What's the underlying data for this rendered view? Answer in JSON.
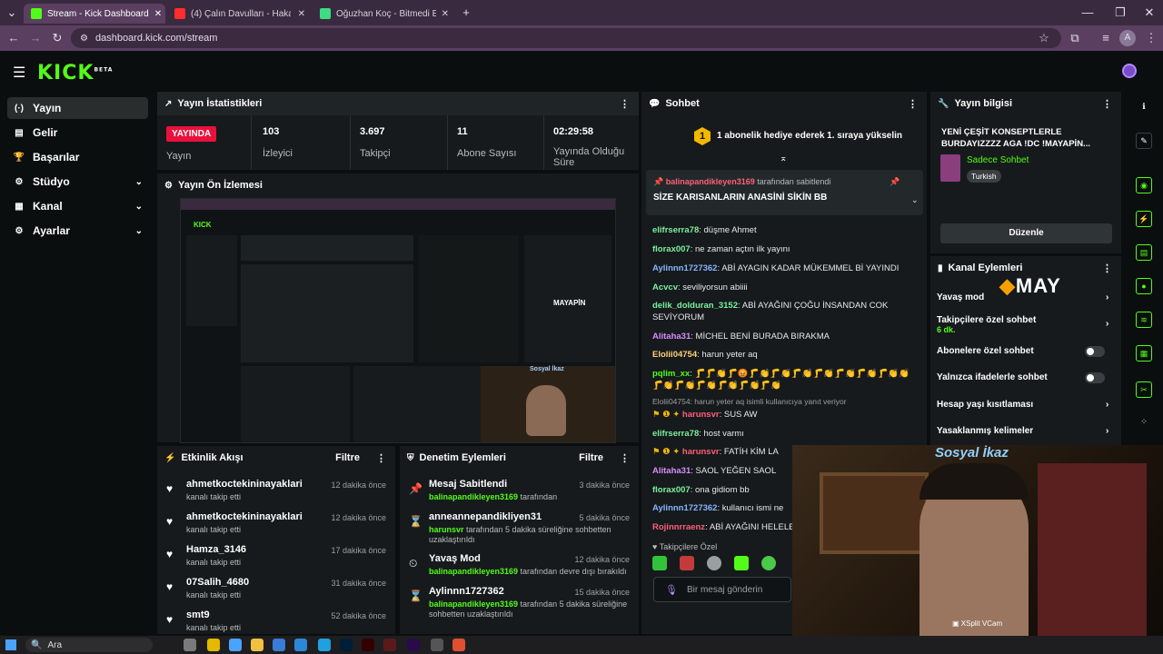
{
  "browser": {
    "tabs": [
      {
        "label": "Stream - Kick Dashboard",
        "active": true
      },
      {
        "label": "(4) Çalın Davulları - Hakan Yeşil..."
      },
      {
        "label": "Oğuzhan Koç - Bitmedi Elem - ..."
      }
    ],
    "new_tab": "+",
    "url": "dashboard.kick.com/stream",
    "profile_initial": "A"
  },
  "header": {
    "logo": "KICK",
    "logo_beta": "BETA"
  },
  "sidebar": {
    "items": [
      {
        "label": "Yayın",
        "icon": "(·)"
      },
      {
        "label": "Gelir",
        "icon": "▤"
      },
      {
        "label": "Başarılar",
        "icon": "🏆"
      },
      {
        "label": "Stüdyo",
        "icon": "⚙"
      },
      {
        "label": "Kanal",
        "icon": "▦"
      },
      {
        "label": "Ayarlar",
        "icon": "⚙"
      }
    ]
  },
  "stats": {
    "title": "Yayın İstatistikleri",
    "live_label": "YAYINDA",
    "status_label": "Yayın",
    "viewers": {
      "value": "103",
      "label": "İzleyici"
    },
    "followers": {
      "value": "3.697",
      "label": "Takipçi"
    },
    "subs": {
      "value": "11",
      "label": "Abone Sayısı"
    },
    "uptime": {
      "value": "02:29:58",
      "label": "Yayında Olduğu Süre"
    }
  },
  "preview": {
    "title": "Yayın Ön İzlemesi",
    "tiny_brand": "MAYAPİN",
    "tiny_title": "Sosyal İkaz"
  },
  "activity": {
    "title": "Etkinlik Akışı",
    "filter": "Filtre",
    "rows": [
      {
        "user": "ahmetkoctekininayaklari",
        "action": "kanalı takip etti",
        "time": "12 dakika önce"
      },
      {
        "user": "ahmetkoctekininayaklari",
        "action": "kanalı takip etti",
        "time": "12 dakika önce"
      },
      {
        "user": "Hamza_3146",
        "action": "kanalı takip etti",
        "time": "17 dakika önce"
      },
      {
        "user": "07Salih_4680",
        "action": "kanalı takip etti",
        "time": "31 dakika önce"
      },
      {
        "user": "smt9",
        "action": "kanalı takip etti",
        "time": "52 dakika önce"
      }
    ]
  },
  "moderation": {
    "title": "Denetim Eylemleri",
    "filter": "Filtre",
    "rows": [
      {
        "title": "Mesaj Sabitlendi",
        "actor": "balinapandikleyen3169",
        "rest": " tarafından",
        "time": "3 dakika önce"
      },
      {
        "title": "anneannepandikliyen31",
        "actor": "harunsvr",
        "rest": " tarafından 5 dakika süreliğine sohbetten uzaklaştırıldı",
        "time": "5 dakika önce"
      },
      {
        "title": "Yavaş Mod",
        "actor": "balinapandikleyen3169",
        "rest": " tarafından devre dışı bırakıldı",
        "time": "12 dakika önce"
      },
      {
        "title": "Aylinnn1727362",
        "actor": "balinapandikleyen3169",
        "rest": " tarafından 5 dakika süreliğine sohbetten uzaklaştırıldı",
        "time": "15 dakika önce"
      }
    ]
  },
  "chat": {
    "title": "Sohbet",
    "gift_banner": "1 abonelik hediye ederek 1. sıraya yükselin",
    "gift_rank": "1",
    "pinned_by": "balinapandikleyen3169",
    "pinned_by_suffix": " tarafından sabitlendi",
    "pinned_message": "SİZE KARISANLARIN ANASİNİ SİKİN BB",
    "reply_note": "Elolii04754: harun yeter aq isimli kullanıcıya yanıt veriyor",
    "followers_only": "Takipçilere Özel",
    "input_placeholder": "Bir mesaj gönderin",
    "messages": [
      {
        "user": "elifrserra78",
        "text": ": düşme Ahmet",
        "color": "#7cf0a0"
      },
      {
        "user": "florax007",
        "text": ": ne zaman açtın ilk yayını",
        "color": "#7cf0a0"
      },
      {
        "user": "Aylinnn1727362",
        "text": ": ABİ AYAGIN KADAR MÜKEMMEL Bİ YAYINDI",
        "color": "#8ab4ff"
      },
      {
        "user": "Acvcv",
        "text": ": seviliyorsun abiiii",
        "color": "#7cf0a0"
      },
      {
        "user": "delik_dolduran_3152",
        "text": ": ABİ AYAĞINI ÇOĞU İNSANDAN COK SEVİYORUM",
        "color": "#7cf0a0"
      },
      {
        "user": "Alitaha31",
        "text": ": MİCHEL BENİ BURADA BIRAKMA",
        "color": "#d98cff"
      },
      {
        "user": "Elolii04754",
        "text": ": harun yeter aq",
        "color": "#ffd27a"
      },
      {
        "user": "pqlim_xx",
        "text": ": 🦵🦵👏🦵😡🦵👏🦵👏🦵👏🦵👏🦵👏🦵👏🦵👏👏🦵👏🦵👏🦵👏🦵👏🦵👏🦵👏",
        "color": "#53fc18"
      },
      {
        "user": "harunsvr",
        "text": ": SUS AW",
        "color": "#ff5f7a"
      },
      {
        "user": "elifrserra78",
        "text": ": host varmı",
        "color": "#7cf0a0"
      },
      {
        "user": "harunsvr",
        "text": ": FATİH KİM LA",
        "color": "#ff5f7a"
      },
      {
        "user": "Alitaha31",
        "text": ": SAOL YEĞEN SAOL",
        "color": "#d98cff"
      },
      {
        "user": "florax007",
        "text": ": ona gidiom bb",
        "color": "#7cf0a0"
      },
      {
        "user": "Aylinnn1727362",
        "text": ": kullanıcı ismi ne",
        "color": "#8ab4ff"
      },
      {
        "user": "Rojinnrraenz",
        "text": ": ABİ AYAĞINI HELELELE",
        "color": "#ff5f7a"
      }
    ]
  },
  "stream_info": {
    "title": "Yayın bilgisi",
    "stream_title": "YENİ ÇEŞİT KONSEPTLERLE BURDAYIZZZZ AGA !DC !MAYAPİN...",
    "category": "Sadece Sohbet",
    "language": "Turkish",
    "edit_button": "Düzenle"
  },
  "channel_actions": {
    "title": "Kanal Eylemleri",
    "brand": "MAY",
    "items": [
      {
        "label": "Yavaş mod",
        "type": "chevron"
      },
      {
        "label": "Takipçilere özel sohbet",
        "sub": "6 dk.",
        "type": "chevron"
      },
      {
        "label": "Abonelere özel sohbet",
        "type": "toggle"
      },
      {
        "label": "Yalnızca ifadelerle sohbet",
        "type": "toggle"
      },
      {
        "label": "Hesap yaşı kısıtlaması",
        "type": "chevron"
      },
      {
        "label": "Yasaklanmış kelimeler",
        "type": "chevron"
      }
    ]
  },
  "webcam": {
    "overlay_title": "Sosyal İkaz",
    "source_label": "XSplit VCam"
  },
  "taskbar": {
    "search": "Ara"
  }
}
